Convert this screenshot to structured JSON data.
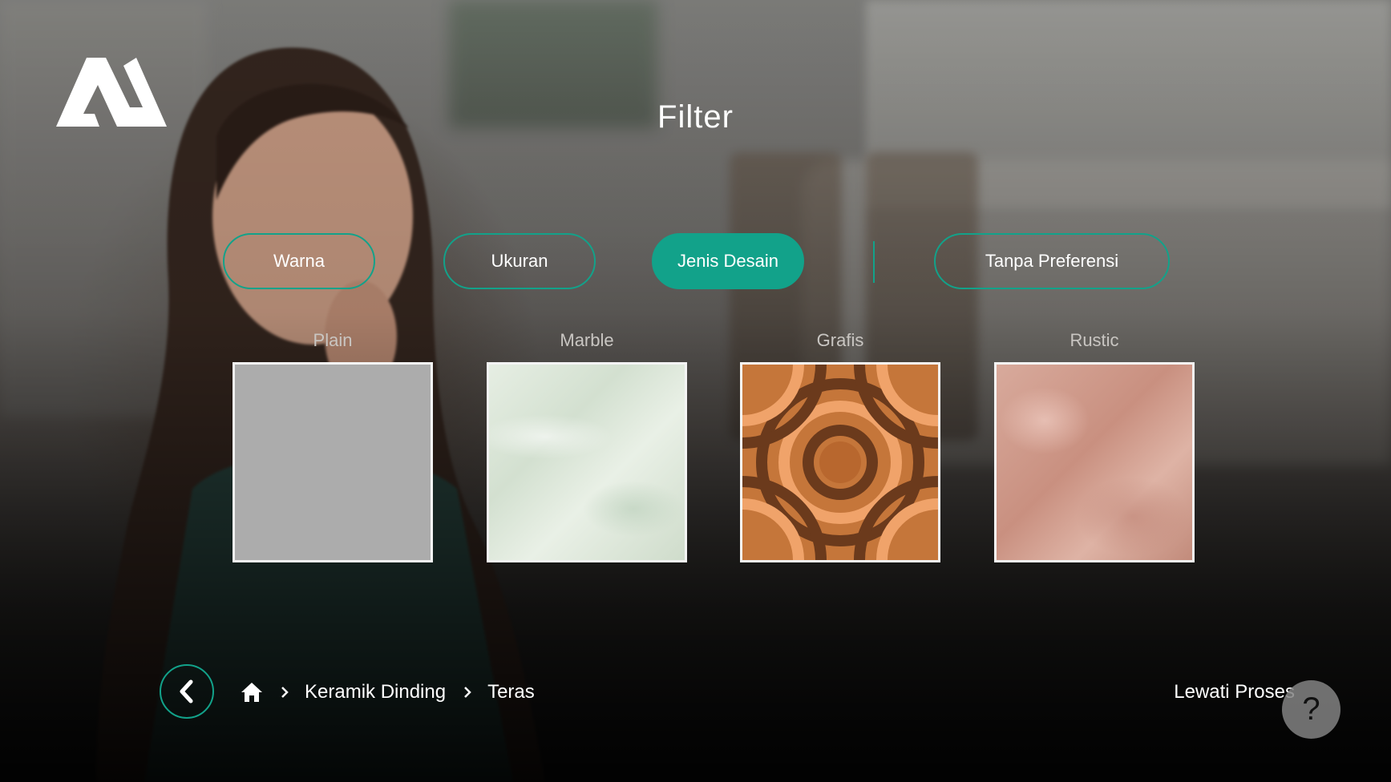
{
  "header": {
    "logo_icon": "brand-logo-icon",
    "title": "Filter"
  },
  "tabs": [
    {
      "label": "Warna",
      "active": false
    },
    {
      "label": "Ukuran",
      "active": false
    },
    {
      "label": "Jenis Desain",
      "active": true
    },
    {
      "label": "Tanpa Preferensi",
      "active": false
    }
  ],
  "design_options": [
    {
      "label": "Plain",
      "swatch": "plain-gray-tile"
    },
    {
      "label": "Marble",
      "swatch": "marble-tile"
    },
    {
      "label": "Grafis",
      "swatch": "graphic-pattern-tile"
    },
    {
      "label": "Rustic",
      "swatch": "rustic-tile"
    }
  ],
  "footer": {
    "back_icon": "chevron-left-icon",
    "breadcrumb": {
      "home_icon": "home-icon",
      "items": [
        "Keramik Dinding",
        "Teras"
      ]
    },
    "skip_label": "Lewati Proses",
    "help_label": "?"
  },
  "colors": {
    "accent": "#12a28a",
    "plain_swatch": "#acacac"
  }
}
